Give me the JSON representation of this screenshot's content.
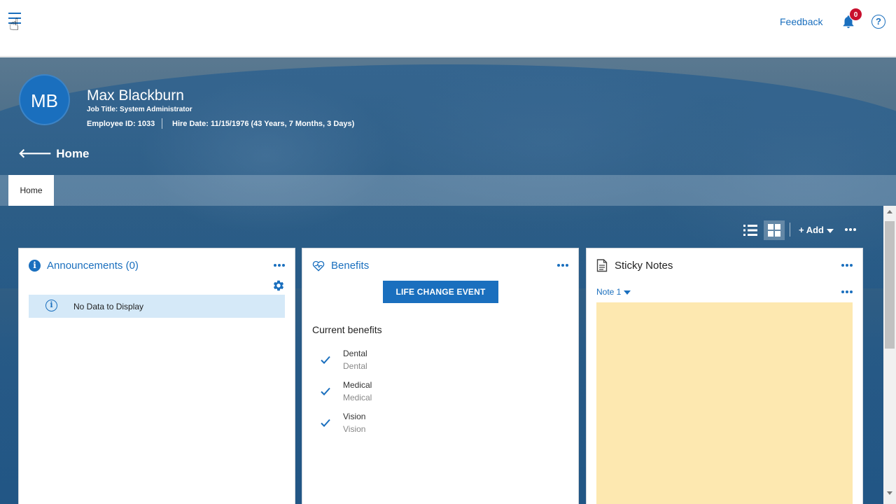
{
  "topbar": {
    "menu_icon": "hamburger-menu-icon",
    "feedback_label": "Feedback",
    "notifications_count": "0",
    "help_glyph": "?"
  },
  "profile": {
    "initials": "MB",
    "name": "Max Blackburn",
    "job_title": "Job Title: System Administrator",
    "employee_id": "Employee ID: 1033",
    "hire_date": "Hire Date: 11/15/1976 (43 Years, 7 Months, 3 Days)"
  },
  "nav": {
    "back_label": "Home",
    "tabs": [
      {
        "label": "Home",
        "active": true
      }
    ]
  },
  "toolbar": {
    "add_label": "+ Add",
    "view_mode": "grid"
  },
  "cards": {
    "announcements": {
      "title": "Announcements (0)",
      "empty_message": "No Data to Display"
    },
    "benefits": {
      "title": "Benefits",
      "button_label": "LIFE CHANGE EVENT",
      "section_label": "Current benefits",
      "items": [
        {
          "name": "Dental",
          "sub": "Dental"
        },
        {
          "name": "Medical",
          "sub": "Medical"
        },
        {
          "name": "Vision",
          "sub": "Vision"
        }
      ]
    },
    "sticky_notes": {
      "title": "Sticky Notes",
      "selected_note": "Note 1"
    }
  },
  "colors": {
    "accent": "#1a6fbe",
    "badge": "#c8102e",
    "note_background": "#fde8b0",
    "info_background": "#d5e9f8"
  }
}
